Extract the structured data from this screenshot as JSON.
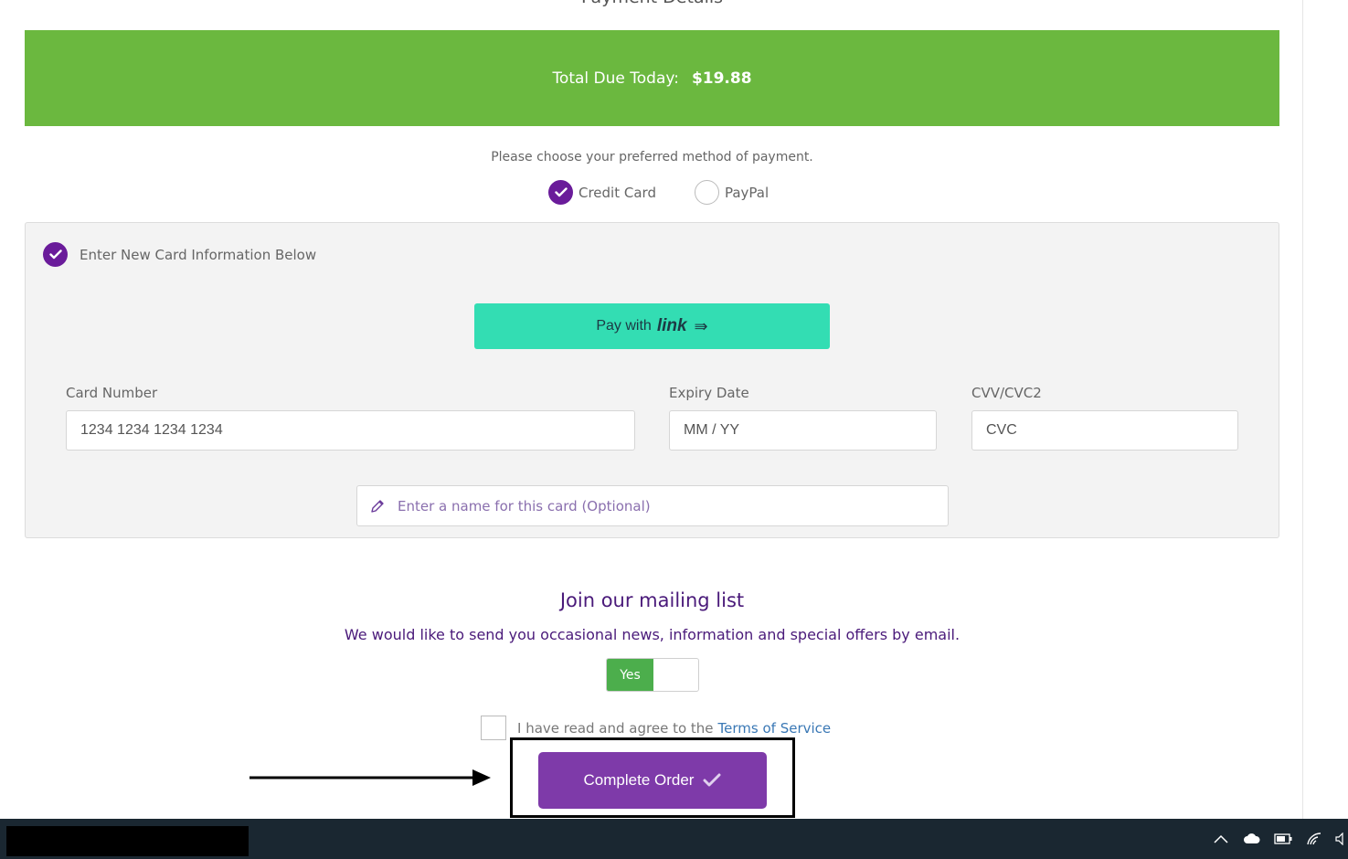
{
  "section": {
    "title": "Payment Details"
  },
  "total": {
    "label": "Total Due Today:",
    "amount": "$19.88"
  },
  "payment_method": {
    "prompt": "Please choose your preferred method of payment.",
    "options": [
      {
        "label": "Credit Card",
        "selected": true
      },
      {
        "label": "PayPal",
        "selected": false
      }
    ]
  },
  "card": {
    "new_card_label": "Enter New Card Information Below",
    "link_button": {
      "prefix": "Pay with",
      "brand": "link",
      "arrow": "⇛"
    },
    "fields": {
      "card_number": {
        "label": "Card Number",
        "placeholder": "1234 1234 1234 1234"
      },
      "expiry": {
        "label": "Expiry Date",
        "placeholder": "MM / YY"
      },
      "cvv": {
        "label": "CVV/CVC2",
        "placeholder": "CVC"
      }
    },
    "card_name_placeholder": "Enter a name for this card (Optional)"
  },
  "mailing": {
    "title": "Join our mailing list",
    "text": "We would like to send you occasional news, information and special offers by email.",
    "toggle_label": "Yes"
  },
  "tos": {
    "text": "I have read and agree to the",
    "link": "Terms of Service"
  },
  "complete_order": {
    "label": "Complete Order"
  },
  "colors": {
    "accent_green": "#6bb83f",
    "brand_purple": "#6a1b9a",
    "button_purple": "#7e3aa9",
    "link_teal": "#33ddb3",
    "taskbar": "#1a2731"
  }
}
